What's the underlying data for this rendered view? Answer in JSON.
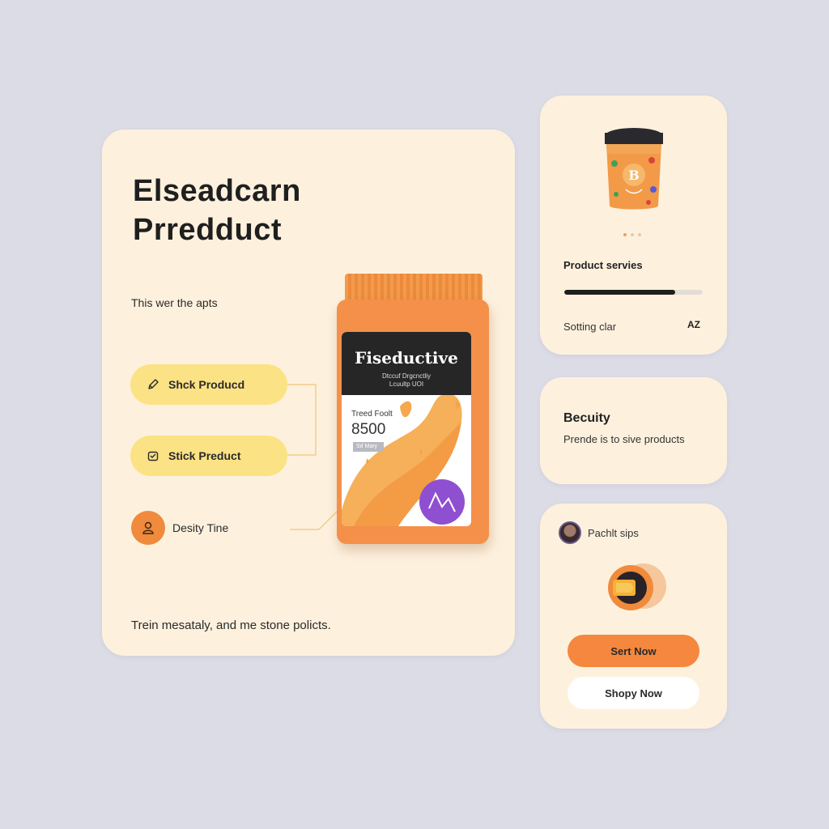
{
  "main": {
    "title_line1": "Elseadcarn",
    "title_line2": "Prredduct",
    "subtitle": "This wer the apts",
    "pill_1_label": "Shck Producd",
    "pill_1_icon": "pencil-icon",
    "pill_2_label": "Stick Preduct",
    "pill_2_icon": "box-icon",
    "person_label": "Desity Tine",
    "person_icon": "person-icon",
    "footer": "Trein mesataly, and me stone policts."
  },
  "package": {
    "brand": "Fiseductive",
    "tagline_1": "Dtccuf Drgcnctliy",
    "tagline_2": "Lcuultp UOI",
    "label": "Treed Foolt",
    "price": "8500",
    "chip": "Sd Mary",
    "colors": {
      "body": "#f4904a",
      "header": "#262626",
      "accent": "#8e4fd0"
    }
  },
  "services": {
    "title": "Product servies",
    "progress": 0.8,
    "setting_label": "Sotting clar",
    "setting_icon": "AZ",
    "jar_letter": "B"
  },
  "beauty": {
    "title": "Becuity",
    "text": "Prende is to sive products"
  },
  "tips": {
    "title": "Pachlt sips",
    "sort_button": "Sert Now",
    "shop_button": "Shopy Now"
  },
  "colors": {
    "background": "#dcdce6",
    "card": "#fdf1de",
    "pill": "#fbe284",
    "accent": "#f5873e"
  }
}
